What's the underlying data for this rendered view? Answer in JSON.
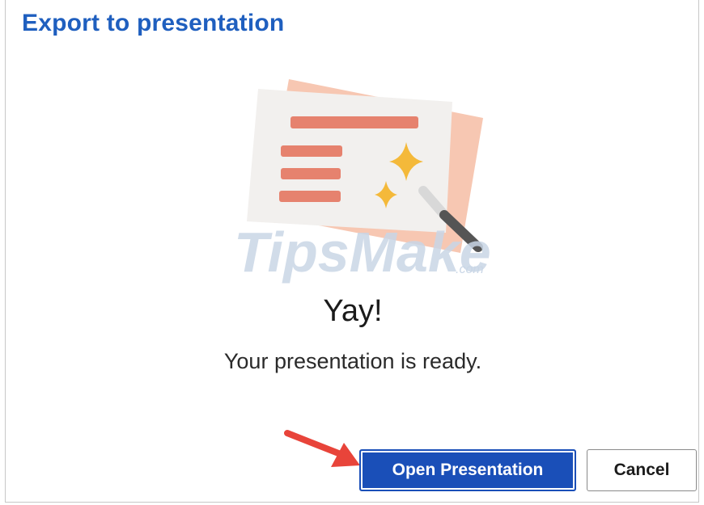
{
  "dialog": {
    "title": "Export to presentation",
    "heading": "Yay!",
    "message": "Your presentation is ready."
  },
  "illustration": {
    "name": "presentation-with-magic-wand",
    "colors": {
      "back_slide": "#f7c7b2",
      "front_slide": "#f2f0ee",
      "lines": "#e6826e",
      "sparkles": "#f4b93a",
      "wand": "#555555"
    }
  },
  "watermark": {
    "text": "TipsMake",
    "suffix": ".com"
  },
  "buttons": {
    "primary_label": "Open Presentation",
    "secondary_label": "Cancel"
  },
  "annotation": {
    "arrow_color": "#e8443a"
  },
  "colors": {
    "accent": "#1f5fbf",
    "primary_button": "#1a4fb8"
  }
}
